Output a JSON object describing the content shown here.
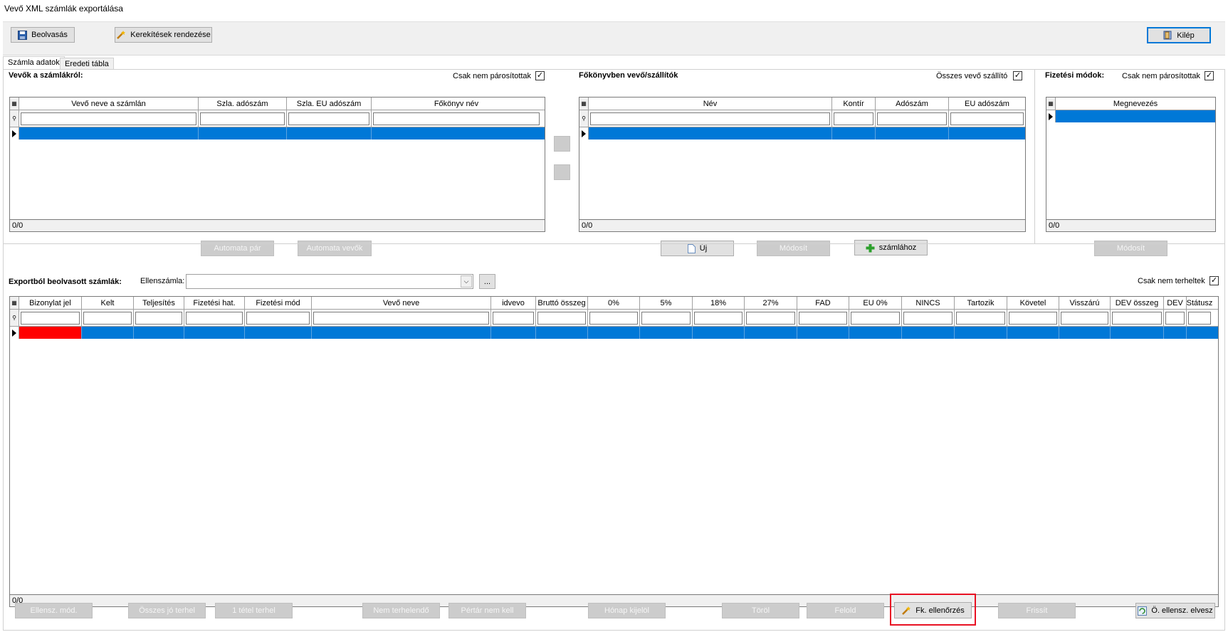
{
  "window": {
    "title": "Vevő XML számlák exportálása"
  },
  "toolbar": {
    "read_label": "Beolvasás",
    "rounding_label": "Kerekítések rendezése",
    "exit_label": "Kilép"
  },
  "tabs": [
    {
      "label": "Számla adatok"
    },
    {
      "label": "Eredeti tábla"
    }
  ],
  "customers": {
    "header": "Vevők a számlákról:",
    "only_unpaired_label": "Csak nem párosítottak",
    "columns": [
      "Vevő neve a számlán",
      "Szla. adószám",
      "Szla. EU adószám",
      "Főkönyv név"
    ],
    "count": "0/0",
    "auto_pair_label": "Automata pár",
    "auto_customers_label": "Automata vevők"
  },
  "ledger": {
    "header": "Főkönyvben vevő/szállítók",
    "all_label": "Összes vevő szállító",
    "columns": [
      "Név",
      "Kontír",
      "Adószám",
      "EU adószám"
    ],
    "count": "0/0",
    "new_label": "Új",
    "modify_label": "Módosít",
    "to_invoice_label": "számlához"
  },
  "payment": {
    "header": "Fizetési módok:",
    "only_unpaired_label": "Csak nem párosítottak",
    "columns": [
      "Megnevezés"
    ],
    "count": "0/0",
    "modify_label": "Módosít"
  },
  "invoices": {
    "header": "Exportból beolvasott számlák:",
    "counter_account_label": "Ellenszámla:",
    "counter_account_value": "",
    "browse_label": "...",
    "only_unposted_label": "Csak nem terheltek",
    "columns": [
      "Bizonylat jel",
      "Kelt",
      "Teljesítés",
      "Fizetési hat.",
      "Fizetési mód",
      "Vevő neve",
      "idvevo",
      "Bruttó összeg",
      "0%",
      "5%",
      "18%",
      "27%",
      "FAD",
      "EU 0%",
      "NINCS",
      "Tartozik",
      "Követel",
      "Visszárú",
      "DEV összeg",
      "DEV",
      "Státusz"
    ],
    "count": "0/0"
  },
  "bottom": {
    "counter_mod": "Ellensz. mód.",
    "all_post": "Összes jó terhel",
    "one_post": "1 tétel terhel",
    "not_post": "Nem terhelendő",
    "pair_not": "Pértár nem kell",
    "month_close": "Hónap kijelöl",
    "delete": "Töröl",
    "process": "Felold",
    "fk_check": "Fk. ellenőrzés",
    "refresh": "Frissít",
    "counter_drop": "Ö. ellensz. elvesz"
  },
  "colors": {
    "selection": "#0078d7",
    "error_cell": "#ff0000",
    "highlight_border": "#e81123"
  }
}
